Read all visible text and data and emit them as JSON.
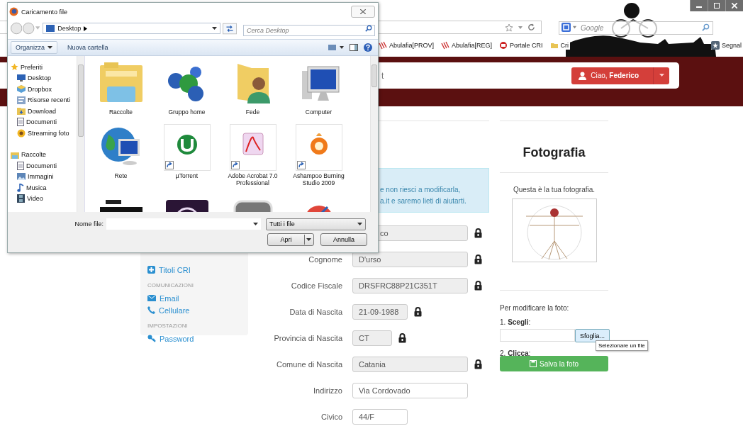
{
  "browser": {
    "search_placeholder": "Google",
    "bookmarks": [
      {
        "kind": "stripes",
        "label": "Abulafia[PROV]"
      },
      {
        "kind": "stripes",
        "label": "Abulafia[REG]"
      },
      {
        "kind": "badge",
        "label": "Portale CRI"
      },
      {
        "kind": "folder",
        "label": "Cri"
      }
    ],
    "bookmark_end": {
      "kind": "star",
      "label": "Segnal"
    }
  },
  "navbar": {
    "brand": "t",
    "user_button": "Ciao, **Federico**"
  },
  "sidebar": {
    "items": [
      {
        "kind": "plus",
        "label": "Titoli CRI"
      },
      {
        "kind": "heading",
        "label": "COMUNICAZIONI"
      },
      {
        "kind": "mail",
        "label": "Email"
      },
      {
        "kind": "phone",
        "label": "Cellulare"
      },
      {
        "kind": "heading",
        "label": "IMPOSTAZIONI"
      },
      {
        "kind": "key",
        "label": "Password"
      }
    ]
  },
  "alert": {
    "lines": [
      "e non riesci a modificarla,",
      "a.it e saremo lieti di aiutarti."
    ]
  },
  "form": {
    "fields": [
      {
        "kind": "covered",
        "value": "co",
        "locked": true
      },
      {
        "kind": "wide",
        "label": "Cognome",
        "value": "D'urso",
        "locked": true
      },
      {
        "kind": "wide",
        "label": "Codice Fiscale",
        "value": "DRSFRC88P21C351T",
        "locked": true
      },
      {
        "kind": "medium",
        "label": "Data di Nascita",
        "value": "21-09-1988",
        "locked": true
      },
      {
        "kind": "short",
        "label": "Provincia di Nascita",
        "value": "CT",
        "locked": true
      },
      {
        "kind": "wide",
        "label": "Comune di Nascita",
        "value": "Catania",
        "locked": true
      },
      {
        "kind": "wide",
        "label": "Indirizzo",
        "value": "Via Cordovado",
        "locked": false
      },
      {
        "kind": "medium",
        "label": "Civico",
        "value": "44/F",
        "locked": false
      }
    ]
  },
  "photo": {
    "title": "Fotografia",
    "caption": "Questa è la tua fotografia.",
    "change_label": "Per modificare la foto:",
    "step1": "1. **Scegli**:",
    "browse_button": "Sfoglia...",
    "step2": "2. **Clicca**:",
    "tooltip": "Selezionare un file",
    "save_button": "Salva la foto"
  },
  "dialog": {
    "title": "Caricamento file",
    "path": "Desktop",
    "search_placeholder": "Cerca Desktop",
    "organize_button": "Organizza",
    "new_folder_button": "Nuova cartella",
    "nav": [
      {
        "kind": "star",
        "label": "Preferiti",
        "children": [
          {
            "kind": "monitor",
            "label": "Desktop"
          },
          {
            "kind": "box",
            "label": "Dropbox"
          },
          {
            "kind": "recent",
            "label": "Risorse recenti"
          },
          {
            "kind": "folder",
            "label": "Download"
          },
          {
            "kind": "doc",
            "label": "Documenti"
          },
          {
            "kind": "sun",
            "label": "Streaming foto"
          }
        ]
      },
      {
        "kind": "library",
        "label": "Raccolte",
        "children": [
          {
            "kind": "doc",
            "label": "Documenti"
          },
          {
            "kind": "picture",
            "label": "Immagini"
          },
          {
            "kind": "note",
            "label": "Musica"
          },
          {
            "kind": "film",
            "label": "Video"
          }
        ]
      }
    ],
    "items": [
      {
        "kind": "library",
        "label": "Raccolte",
        "shortcut": false
      },
      {
        "kind": "homegroup",
        "label": "Gruppo home",
        "shortcut": false
      },
      {
        "kind": "userfolder",
        "label": "Fede",
        "shortcut": false
      },
      {
        "kind": "computer",
        "label": "Computer",
        "shortcut": false
      },
      {
        "kind": "network",
        "label": "Rete",
        "shortcut": false
      },
      {
        "kind": "torrent",
        "label": "µTorrent",
        "shortcut": true
      },
      {
        "kind": "pdf",
        "label": "Adobe Acrobat 7.0 Professional",
        "shortcut": true
      },
      {
        "kind": "disc",
        "label": "Ashampoo Burning Studio 2009",
        "shortcut": true
      },
      {
        "kind": "blackapp",
        "shortcut": false
      },
      {
        "kind": "purpleapp",
        "shortcut": false
      },
      {
        "kind": "greyapp",
        "shortcut": false
      },
      {
        "kind": "redapp",
        "shortcut": false
      }
    ],
    "filename_label": "Nome file:",
    "filetype": "Tutti i file",
    "open_button": "Apri",
    "cancel_button": "Annulla"
  }
}
